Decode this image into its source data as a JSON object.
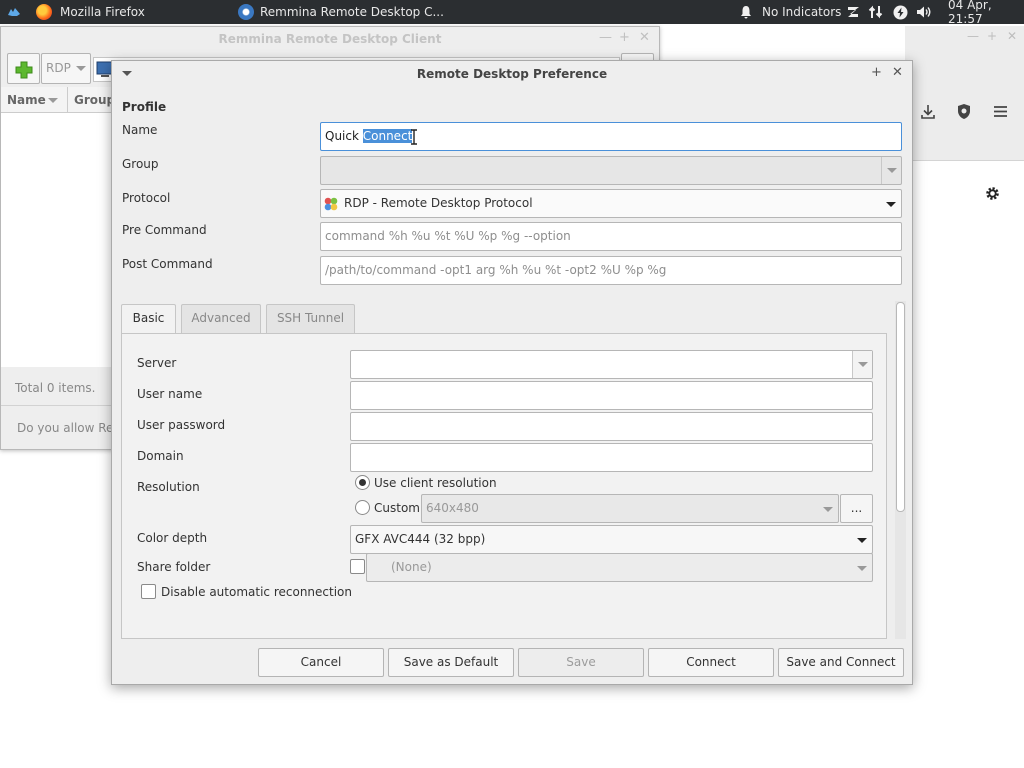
{
  "panel": {
    "app1": "Mozilla Firefox",
    "app2": "Remmina Remote Desktop C...",
    "indicators": "No Indicators",
    "clock": "04 Apr, 21:57"
  },
  "bg_window": {
    "title": "Remmina Remote Desktop Client",
    "protocol": "RDP",
    "col_name": "Name",
    "col_group": "Group",
    "status": "Total 0 items.",
    "notice": "Do you allow Rem"
  },
  "dialog": {
    "title": "Remote Desktop Preference",
    "section": "Profile",
    "name_label": "Name",
    "name_value_plain": "Quick ",
    "name_value_selected": "Connect",
    "group_label": "Group",
    "group_value": "",
    "protocol_label": "Protocol",
    "protocol_value": "RDP - Remote Desktop Protocol",
    "precmd_label": "Pre Command",
    "precmd_placeholder": "command %h %u %t %U %p %g --option",
    "postcmd_label": "Post Command",
    "postcmd_placeholder": "/path/to/command -opt1 arg %h %u %t -opt2 %U %p %g",
    "tabs": [
      {
        "label": "Basic",
        "active": true
      },
      {
        "label": "Advanced",
        "active": false
      },
      {
        "label": "SSH Tunnel",
        "active": false
      }
    ],
    "basic": {
      "server_label": "Server",
      "server_value": "",
      "username_label": "User name",
      "username_value": "",
      "password_label": "User password",
      "password_value": "",
      "domain_label": "Domain",
      "domain_value": "",
      "resolution_label": "Resolution",
      "res_client": "Use client resolution",
      "res_custom": "Custom",
      "res_custom_value": "640x480",
      "res_more": "...",
      "colordepth_label": "Color depth",
      "colordepth_value": "GFX AVC444 (32 bpp)",
      "share_label": "Share folder",
      "share_value": "(None)",
      "disable_reconnect": "Disable automatic reconnection"
    },
    "buttons": {
      "cancel": "Cancel",
      "save_default": "Save as Default",
      "save": "Save",
      "connect": "Connect",
      "save_connect": "Save and Connect"
    }
  },
  "colors": {
    "panel_bg": "#2b2e31",
    "selection": "#4a90d9",
    "dialog_bg": "#eeeeee"
  }
}
